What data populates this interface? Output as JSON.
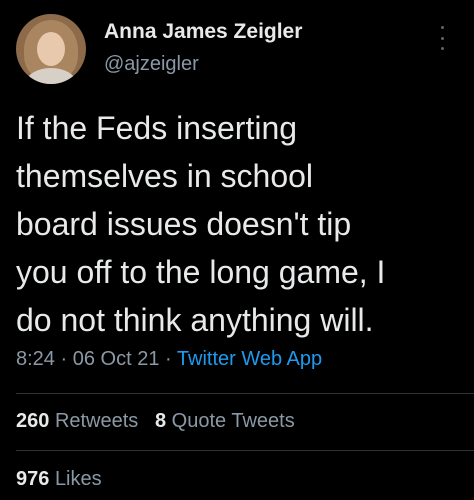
{
  "author": {
    "name": "Anna James Zeigler",
    "handle": "@ajzeigler"
  },
  "tweet": {
    "text": "If the Feds inserting\nthemselves in school\nboard issues doesn't tip\nyou off to the long game, I\ndo not think anything will."
  },
  "meta": {
    "time": "8:24",
    "separator": "·",
    "date": "06 Oct 21",
    "app": "Twitter Web App"
  },
  "stats": {
    "retweets_count": "260",
    "retweets_label": "Retweets",
    "quotes_count": "8",
    "quotes_label": "Quote Tweets",
    "likes_count": "976",
    "likes_label": "Likes"
  },
  "colors": {
    "background": "#000000",
    "text": "#e7e9ea",
    "secondary": "#8b98a5",
    "accent": "#1d9bf0"
  }
}
